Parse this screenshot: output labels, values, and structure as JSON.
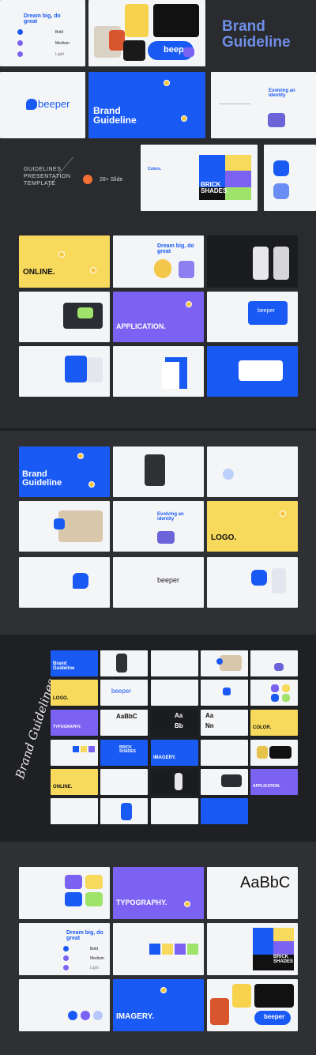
{
  "hero": {
    "title_line1": "Brand",
    "title_line2": "Guideline",
    "template_lines": [
      "GUIDELINES",
      "PRESENTATION",
      "TEMPLATE"
    ],
    "slide_count": "28+ Slide"
  },
  "slides": {
    "dream": "Dream big, do great",
    "weights": [
      "Bold",
      "Medium",
      "Light"
    ],
    "beeper": "beeper",
    "brand_guideline": "Brand Guideline",
    "evolving": "Evolving an identity",
    "colors": "Colors.",
    "brick": "BRICK SHADES",
    "online": "ONLINE.",
    "application": "APPLICATION.",
    "logo": "LOGO.",
    "typography": "TYPOGRAPHY.",
    "imagery": "IMAGERY.",
    "color": "COLOR.",
    "aabbc": "AaBbC",
    "aa": "Aa",
    "bb": "Bb",
    "nn": "Nn"
  },
  "side_script": "Brand Guidelines",
  "colors": {
    "blue": "#1a5af4",
    "purple": "#7c62f3",
    "yellow": "#f7d95b",
    "dark": "#1b1c1f"
  }
}
